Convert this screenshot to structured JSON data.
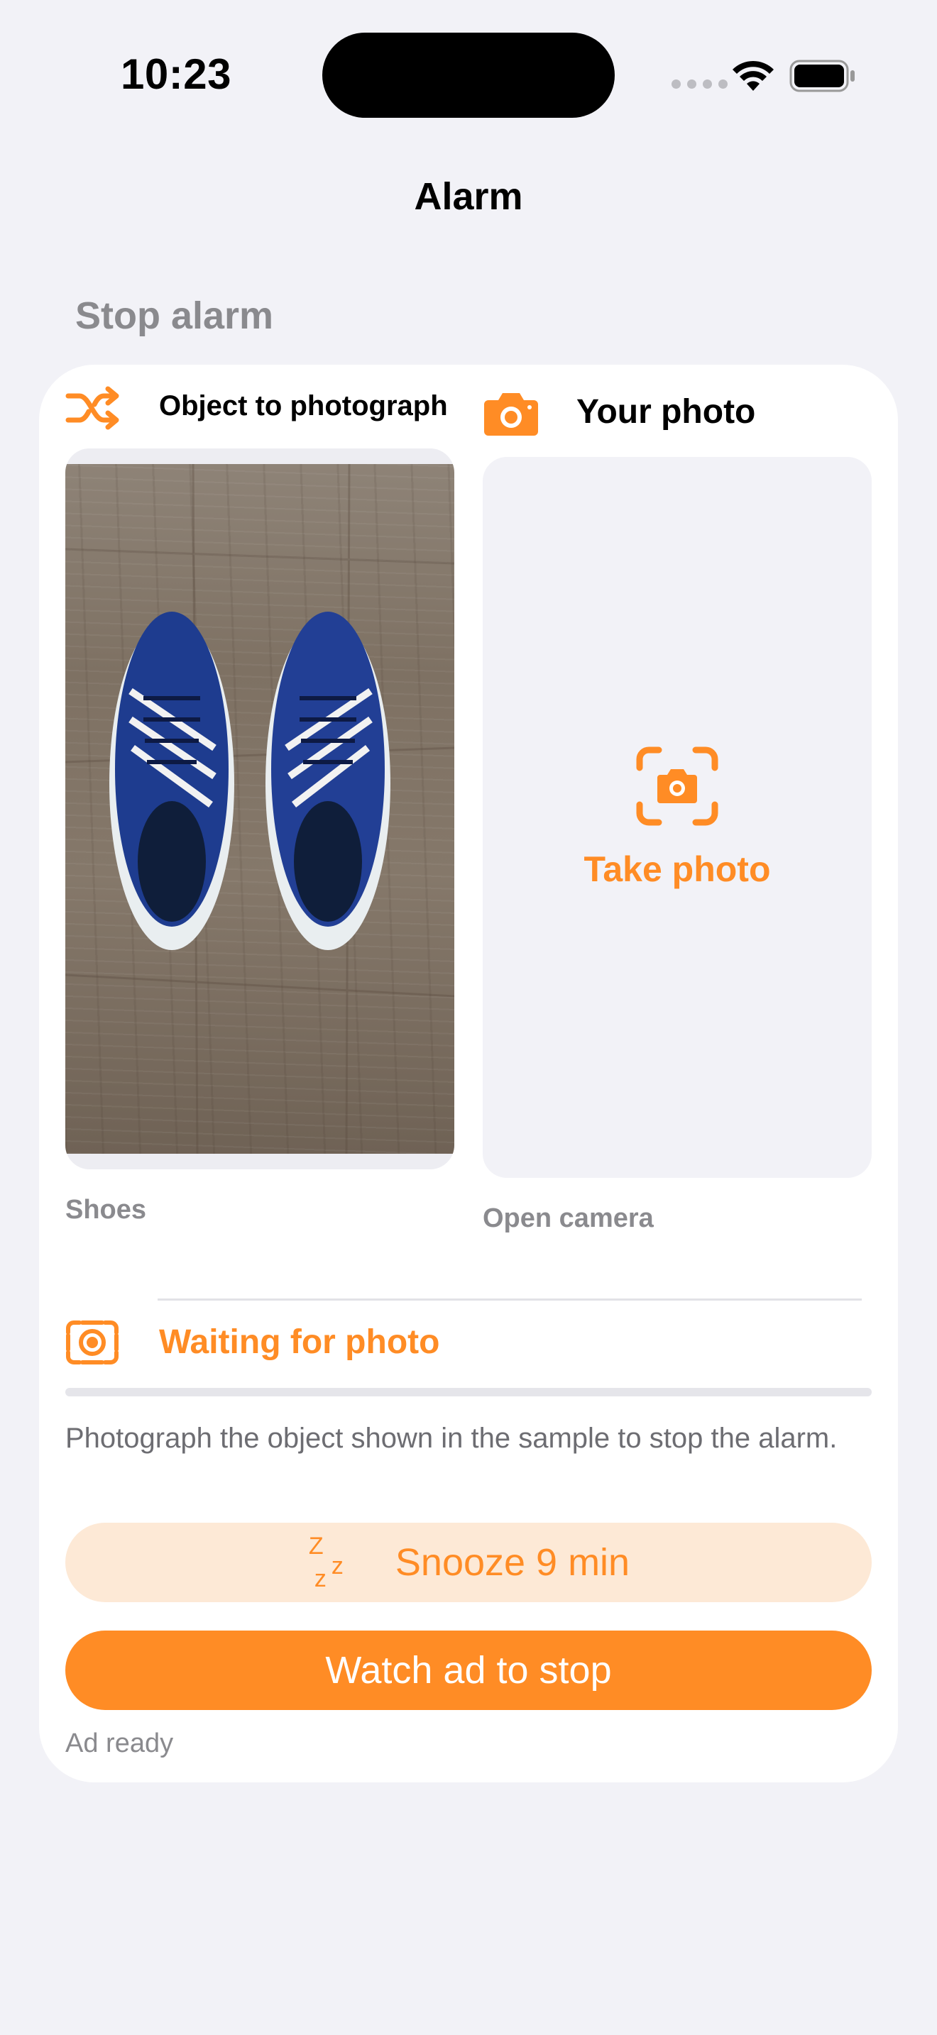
{
  "status_bar": {
    "time": "10:23"
  },
  "nav": {
    "title": "Alarm"
  },
  "section": {
    "header": "Stop alarm"
  },
  "left_column": {
    "title": "Object to photograph",
    "caption": "Shoes",
    "icon": "shuffle-icon"
  },
  "right_column": {
    "title": "Your photo",
    "action_label": "Take photo",
    "caption": "Open camera",
    "icon": "camera-icon"
  },
  "status": {
    "text": "Waiting for photo",
    "progress": 0
  },
  "instructions": "Photograph the object shown in the sample to stop the alarm.",
  "buttons": {
    "snooze": "Snooze 9 min",
    "stop": "Watch ad to stop"
  },
  "ad_status": "Ad ready",
  "colors": {
    "accent": "#FF8C25",
    "accent_light": "#FDE9D6",
    "background": "#F2F2F7",
    "card": "#FFFFFF",
    "secondary_text": "#8A8A8E"
  }
}
